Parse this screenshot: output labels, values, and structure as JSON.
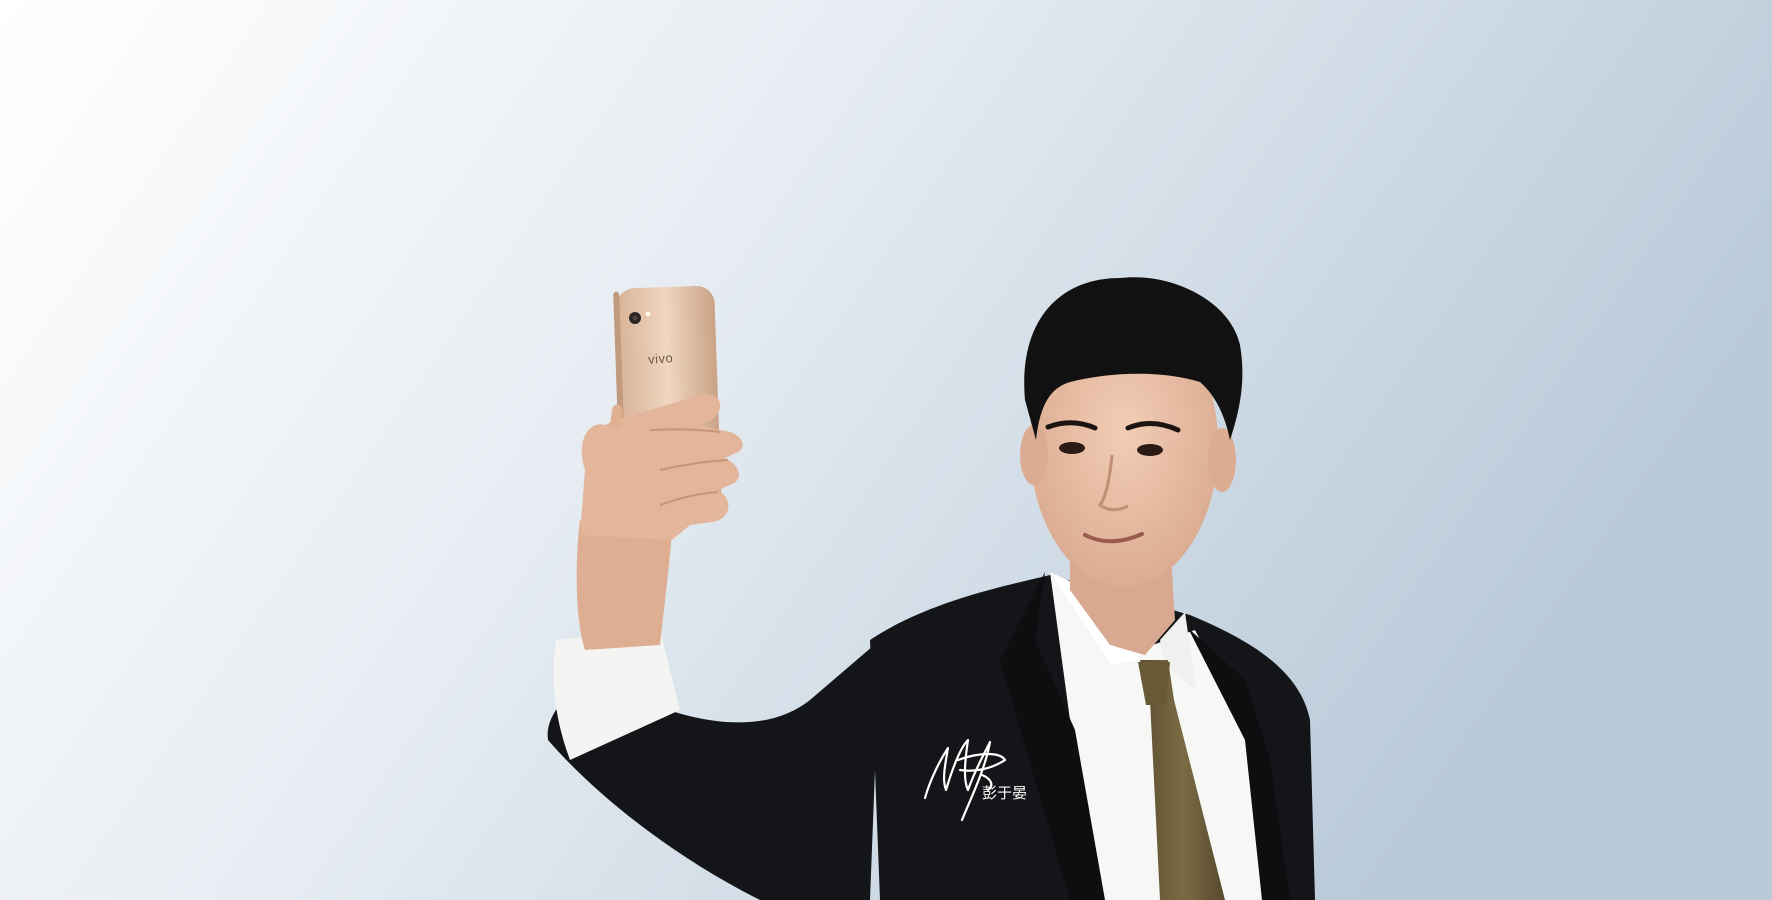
{
  "scene": {
    "palette": {
      "background_light": "#ffffff",
      "background_blue": "#b9cad9",
      "suit": "#141518",
      "shirt": "#f7f7f5",
      "tie": "#6e5f3c",
      "phone": "#e8c9ad",
      "hair": "#111111",
      "skin": "#e7bfa7"
    }
  },
  "phone": {
    "brand_text": "vivo"
  },
  "signature": {
    "name_text": "彭于晏"
  }
}
